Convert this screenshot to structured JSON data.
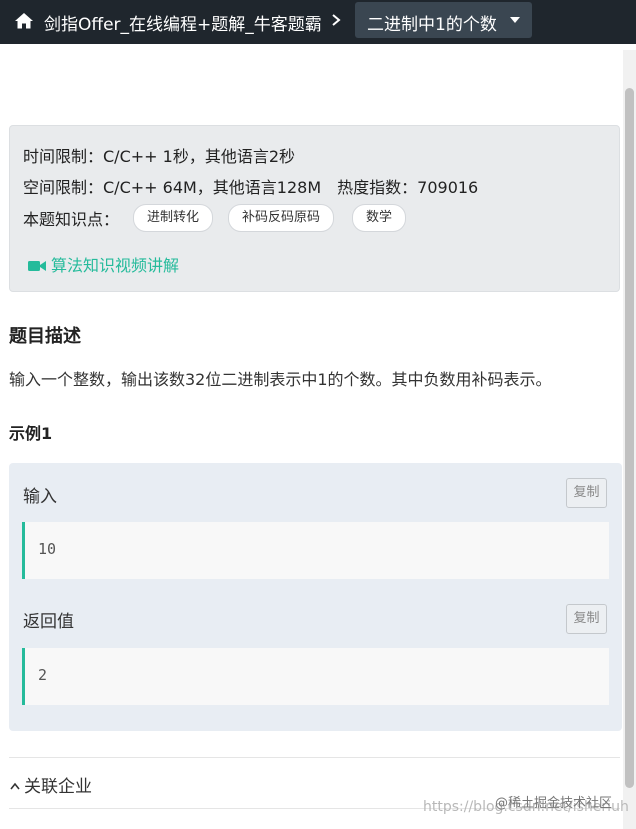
{
  "header": {
    "home_icon": "home-icon",
    "breadcrumb_link": "剑指Offer_在线编程+题解_牛客题霸",
    "separator_icon": "chevron-right-icon",
    "problem_selector": "二进制中1的个数"
  },
  "meta": {
    "time_limit": "时间限制：C/C++ 1秒，其他语言2秒",
    "space_limit": "空间限制：C/C++ 64M，其他语言128M",
    "heat_index": "热度指数：709016",
    "knowledge_label": "本题知识点：",
    "tags": [
      "进制转化",
      "补码反码原码",
      "数学"
    ],
    "video_link": "算法知识视频讲解",
    "video_icon": "video-camera-icon"
  },
  "description": {
    "title": "题目描述",
    "text": "输入一个整数，输出该数32位二进制表示中1的个数。其中负数用补码表示。"
  },
  "example": {
    "title": "示例1",
    "input_label": "输入",
    "input_value": "10",
    "output_label": "返回值",
    "output_value": "2",
    "copy_label": "复制"
  },
  "related": {
    "label": "关联企业",
    "icon": "chevron-up-icon"
  },
  "watermark": {
    "url": "https://blog.csdn.net/isheriuh",
    "site": "@稀土掘金技术社区"
  },
  "colors": {
    "topbar": "#1f262d",
    "accent": "#25bb9b",
    "meta_background": "#e9ebed",
    "example_background": "#e8edf3"
  }
}
